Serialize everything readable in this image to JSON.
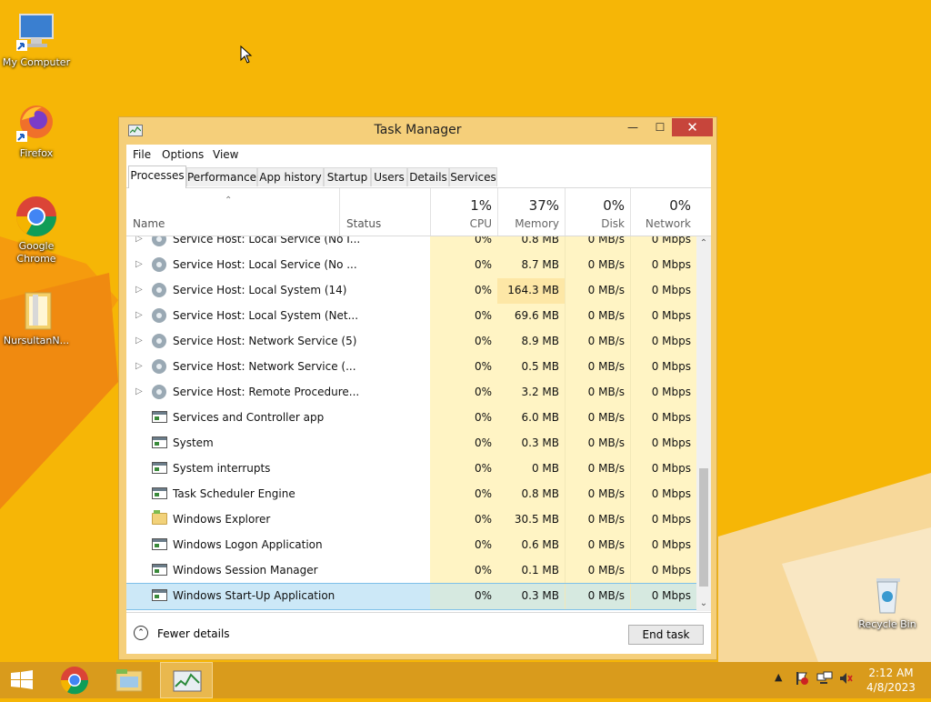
{
  "desktop": {
    "icons": [
      {
        "label": "My Computer"
      },
      {
        "label": "Firefox"
      },
      {
        "label": "Google Chrome"
      },
      {
        "label": "NursultanN..."
      },
      {
        "label": "Recycle Bin"
      }
    ]
  },
  "window": {
    "title": "Task Manager",
    "controls": {
      "minimize": "—",
      "maximize": "☐",
      "close": "✕"
    }
  },
  "menu": {
    "file": "File",
    "options": "Options",
    "view": "View"
  },
  "tabs": [
    "Processes",
    "Performance",
    "App history",
    "Startup",
    "Users",
    "Details",
    "Services"
  ],
  "header": {
    "name": "Name",
    "status": "Status",
    "cpu": {
      "percent": "1%",
      "label": "CPU"
    },
    "memory": {
      "percent": "37%",
      "label": "Memory"
    },
    "disk": {
      "percent": "0%",
      "label": "Disk"
    },
    "network": {
      "percent": "0%",
      "label": "Network"
    }
  },
  "processes": [
    {
      "name": "Service Host: Local Service (No I...",
      "cpu": "0%",
      "memory": "0.8 MB",
      "disk": "0 MB/s",
      "network": "0 Mbps"
    },
    {
      "name": "Service Host: Local Service (No ...",
      "cpu": "0%",
      "memory": "8.7 MB",
      "disk": "0 MB/s",
      "network": "0 Mbps"
    },
    {
      "name": "Service Host: Local System (14)",
      "cpu": "0%",
      "memory": "164.3 MB",
      "disk": "0 MB/s",
      "network": "0 Mbps"
    },
    {
      "name": "Service Host: Local System (Net...",
      "cpu": "0%",
      "memory": "69.6 MB",
      "disk": "0 MB/s",
      "network": "0 Mbps"
    },
    {
      "name": "Service Host: Network Service (5)",
      "cpu": "0%",
      "memory": "8.9 MB",
      "disk": "0 MB/s",
      "network": "0 Mbps"
    },
    {
      "name": "Service Host: Network Service (...",
      "cpu": "0%",
      "memory": "0.5 MB",
      "disk": "0 MB/s",
      "network": "0 Mbps"
    },
    {
      "name": "Service Host: Remote Procedure...",
      "cpu": "0%",
      "memory": "3.2 MB",
      "disk": "0 MB/s",
      "network": "0 Mbps"
    },
    {
      "name": "Services and Controller app",
      "cpu": "0%",
      "memory": "6.0 MB",
      "disk": "0 MB/s",
      "network": "0 Mbps"
    },
    {
      "name": "System",
      "cpu": "0%",
      "memory": "0.3 MB",
      "disk": "0 MB/s",
      "network": "0 Mbps"
    },
    {
      "name": "System interrupts",
      "cpu": "0%",
      "memory": "0 MB",
      "disk": "0 MB/s",
      "network": "0 Mbps"
    },
    {
      "name": "Task Scheduler Engine",
      "cpu": "0%",
      "memory": "0.8 MB",
      "disk": "0 MB/s",
      "network": "0 Mbps"
    },
    {
      "name": "Windows Explorer",
      "cpu": "0%",
      "memory": "30.5 MB",
      "disk": "0 MB/s",
      "network": "0 Mbps"
    },
    {
      "name": "Windows Logon Application",
      "cpu": "0%",
      "memory": "0.6 MB",
      "disk": "0 MB/s",
      "network": "0 Mbps"
    },
    {
      "name": "Windows Session Manager",
      "cpu": "0%",
      "memory": "0.1 MB",
      "disk": "0 MB/s",
      "network": "0 Mbps"
    },
    {
      "name": "Windows Start-Up Application",
      "cpu": "0%",
      "memory": "0.3 MB",
      "disk": "0 MB/s",
      "network": "0 Mbps"
    }
  ],
  "footer": {
    "fewer_details": "Fewer details",
    "end_task": "End task"
  },
  "taskbar": {
    "clock_time": "2:12 AM",
    "clock_date": "4/8/2023"
  },
  "colors": {
    "accent": "#f5b505",
    "taskbar": "#d99b1c",
    "close_button": "#c7453b",
    "selection": "#cce8f7",
    "heat": "#fff4c4"
  }
}
